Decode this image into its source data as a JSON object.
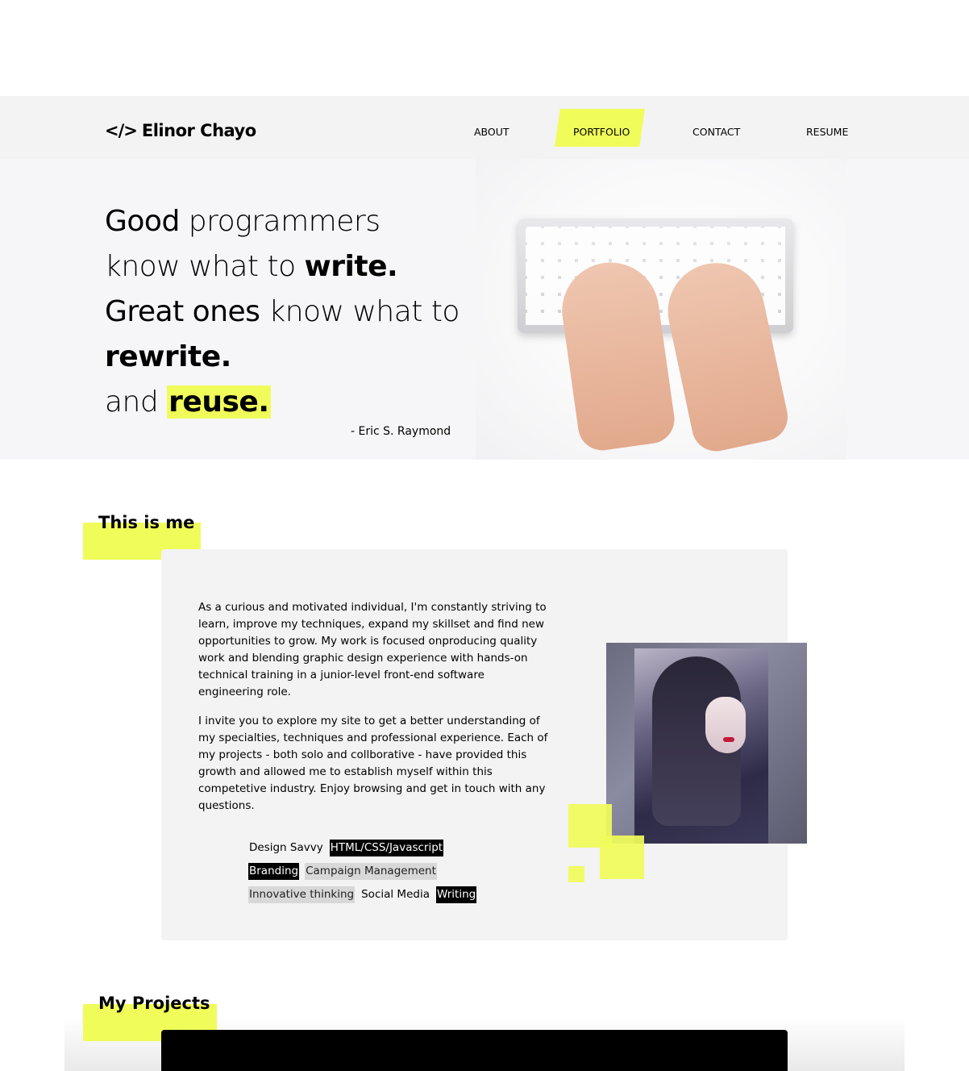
{
  "nav": {
    "logo_icon": "</>",
    "logo_text": "Elinor Chayo",
    "links": [
      {
        "label": "ABOUT"
      },
      {
        "label": "PORTFOLIO",
        "active": true
      },
      {
        "label": "CONTACT"
      },
      {
        "label": "RESUME"
      }
    ]
  },
  "hero": {
    "line1_a": "Good",
    "line1_b": " programmers",
    "line2_a": "know what to ",
    "line2_b": "write.",
    "line3_a": "Great ones",
    "line3_b": " know what to",
    "line4": "rewrite.",
    "line5_a": "and ",
    "line5_b": "reuse.",
    "attribution": "- Eric S. Raymond"
  },
  "about": {
    "heading_a": "This is ",
    "heading_b": "me",
    "paragraph1": "As a curious and motivated individual, I'm constantly striving to learn, improve my techniques, expand my skillset and find new opportunities to grow. My work is focused onproducing quality work and blending graphic design experience with hands-on technical training in a junior-level front-end software engineering role.",
    "paragraph2": "I invite you to explore my site to get a better understanding of my specialties, techniques and professional experience. Each of my projects - both solo and collborative - have provided this growth and allowed me to establish myself within this competetive industry. Enjoy browsing and get in touch with any questions.",
    "skills": [
      [
        "Design Savvy",
        "HTML/CSS/Javascript"
      ],
      [
        "Branding",
        "Campaign Management"
      ],
      [
        "Innovative thinking",
        "Social Media",
        "Writing"
      ]
    ]
  },
  "projects": {
    "heading_a": "My ",
    "heading_b": "Projects"
  },
  "colors": {
    "accent": "#f0fc5a",
    "nav_bg": "#f3f3f3",
    "card_bg": "#f3f3f3"
  }
}
